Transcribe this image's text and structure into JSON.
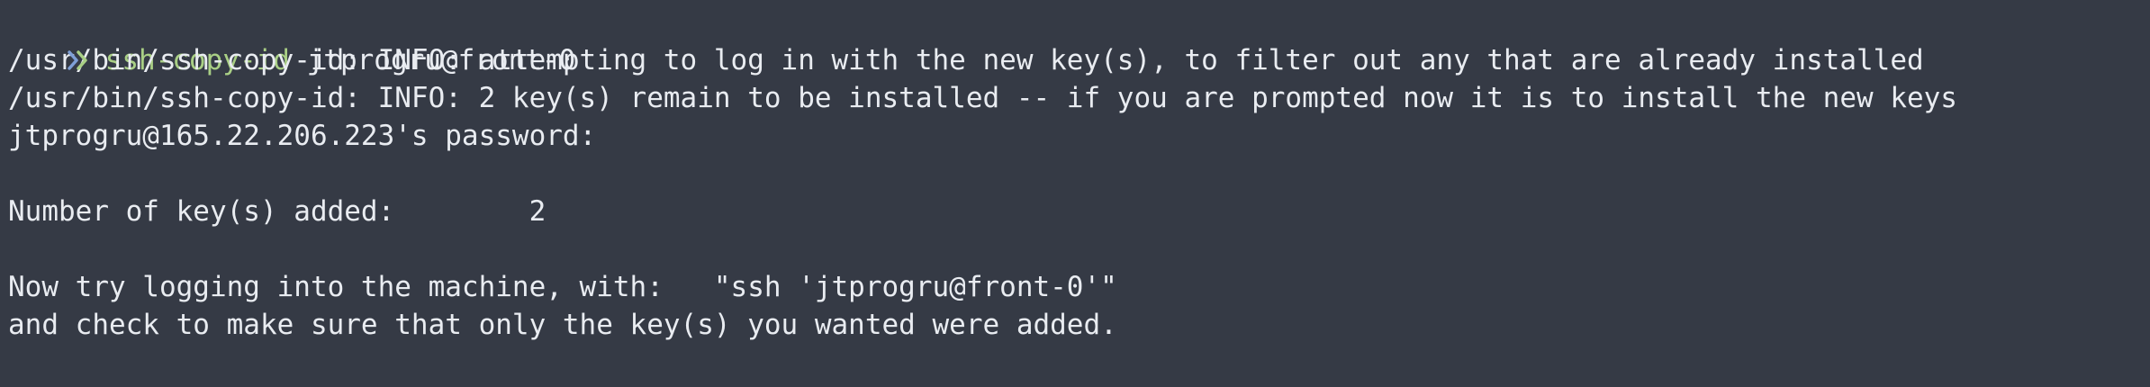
{
  "colors": {
    "background": "#353a45",
    "text": "#e9ecf1",
    "command": "#a9cf85",
    "prompt_arrow_left": "#7fa0d6",
    "prompt_arrow_right": "#a9cf85"
  },
  "prompt": {
    "icon": "prompt-chevron-icon",
    "command": "ssh-copy-id",
    "argument": "jtprogru@front-0"
  },
  "output": {
    "line1": "/usr/bin/ssh-copy-id: INFO: attempting to log in with the new key(s), to filter out any that are already installed",
    "line2": "/usr/bin/ssh-copy-id: INFO: 2 key(s) remain to be installed -- if you are prompted now it is to install the new keys",
    "line3": "jtprogru@165.22.206.223's password:",
    "line4": "Number of key(s) added:        2",
    "line5": "Now try logging into the machine, with:   \"ssh 'jtprogru@front-0'\"",
    "line6": "and check to make sure that only the key(s) you wanted were added."
  }
}
